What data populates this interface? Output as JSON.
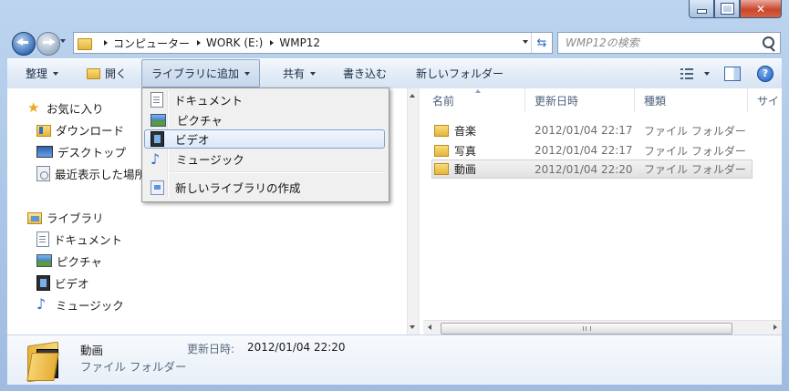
{
  "address": {
    "crumbs": [
      "コンピューター",
      "WORK (E:)",
      "WMP12"
    ]
  },
  "search": {
    "placeholder": "WMP12の検索"
  },
  "toolbar": {
    "organize": "整理",
    "open": "開く",
    "add_to_library": "ライブラリに追加",
    "share": "共有",
    "burn": "書き込む",
    "new_folder": "新しいフォルダー"
  },
  "menu": {
    "items": [
      "ドキュメント",
      "ピクチャ",
      "ビデオ",
      "ミュージック"
    ],
    "hovered": "ビデオ",
    "create_new": "新しいライブラリの作成"
  },
  "nav": {
    "favorites": "お気に入り",
    "favorite_items": [
      "ダウンロード",
      "デスクトップ",
      "最近表示した場所"
    ],
    "libraries": "ライブラリ",
    "library_items": [
      "ドキュメント",
      "ピクチャ",
      "ビデオ",
      "ミュージック"
    ]
  },
  "columns": {
    "name": "名前",
    "date": "更新日時",
    "type": "種類",
    "size": "サイ"
  },
  "files": [
    {
      "name": "音楽",
      "date": "2012/01/04 22:17",
      "type": "ファイル フォルダー",
      "selected": false
    },
    {
      "name": "写真",
      "date": "2012/01/04 22:17",
      "type": "ファイル フォルダー",
      "selected": false
    },
    {
      "name": "動画",
      "date": "2012/01/04 22:20",
      "type": "ファイル フォルダー",
      "selected": true
    }
  ],
  "details": {
    "name": "動画",
    "type": "ファイル フォルダー",
    "date_label": "更新日時:",
    "date": "2012/01/04 22:20"
  },
  "colors": {
    "accent": "#3a6fb5",
    "selection": "#e1e1e1",
    "menu_hover": "#dbe8f8"
  }
}
